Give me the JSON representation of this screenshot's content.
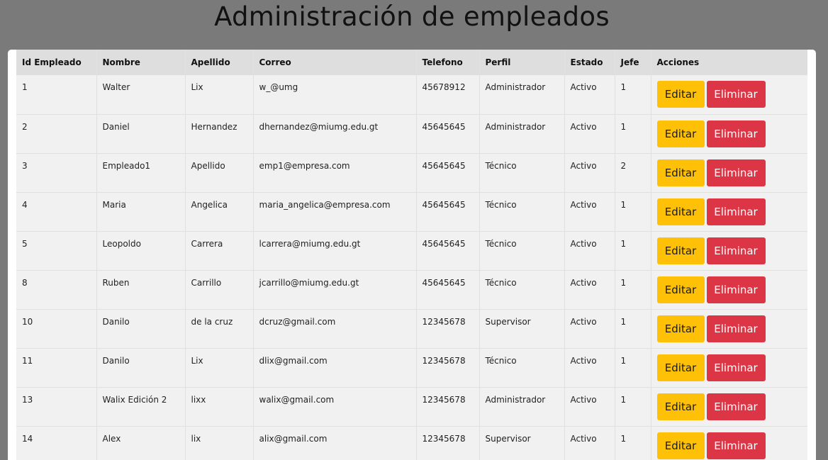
{
  "page": {
    "title": "Administración de empleados"
  },
  "table": {
    "headers": [
      "Id Empleado",
      "Nombre",
      "Apellido",
      "Correo",
      "Telefono",
      "Perfil",
      "Estado",
      "Jefe",
      "Acciones"
    ],
    "actions": {
      "edit_label": "Editar",
      "delete_label": "Eliminar"
    },
    "rows": [
      {
        "id": "1",
        "nombre": "Walter",
        "apellido": "Lix",
        "correo": "w_@umg",
        "telefono": "45678912",
        "perfil": "Administrador",
        "estado": "Activo",
        "jefe": "1"
      },
      {
        "id": "2",
        "nombre": "Daniel",
        "apellido": "Hernandez",
        "correo": "dhernandez@miumg.edu.gt",
        "telefono": "45645645",
        "perfil": "Administrador",
        "estado": "Activo",
        "jefe": "1"
      },
      {
        "id": "3",
        "nombre": "Empleado1",
        "apellido": "Apellido",
        "correo": "emp1@empresa.com",
        "telefono": "45645645",
        "perfil": "Técnico",
        "estado": "Activo",
        "jefe": "2"
      },
      {
        "id": "4",
        "nombre": "Maria",
        "apellido": "Angelica",
        "correo": "maria_angelica@empresa.com",
        "telefono": "45645645",
        "perfil": "Técnico",
        "estado": "Activo",
        "jefe": "1"
      },
      {
        "id": "5",
        "nombre": "Leopoldo",
        "apellido": "Carrera",
        "correo": "lcarrera@miumg.edu.gt",
        "telefono": "45645645",
        "perfil": "Técnico",
        "estado": "Activo",
        "jefe": "1"
      },
      {
        "id": "8",
        "nombre": "Ruben",
        "apellido": "Carrillo",
        "correo": "jcarrillo@miumg.edu.gt",
        "telefono": "45645645",
        "perfil": "Técnico",
        "estado": "Activo",
        "jefe": "1"
      },
      {
        "id": "10",
        "nombre": "Danilo",
        "apellido": "de la cruz",
        "correo": "dcruz@gmail.com",
        "telefono": "12345678",
        "perfil": "Supervisor",
        "estado": "Activo",
        "jefe": "1"
      },
      {
        "id": "11",
        "nombre": "Danilo",
        "apellido": "Lix",
        "correo": "dlix@gmail.com",
        "telefono": "12345678",
        "perfil": "Técnico",
        "estado": "Activo",
        "jefe": "1"
      },
      {
        "id": "13",
        "nombre": "Walix Edición 2",
        "apellido": "lixx",
        "correo": "walix@gmail.com",
        "telefono": "12345678",
        "perfil": "Administrador",
        "estado": "Activo",
        "jefe": "1"
      },
      {
        "id": "14",
        "nombre": "Alex",
        "apellido": "lix",
        "correo": "alix@gmail.com",
        "telefono": "12345678",
        "perfil": "Supervisor",
        "estado": "Activo",
        "jefe": "1"
      }
    ]
  },
  "colors": {
    "backdrop": "#7a7a7a",
    "header_bg": "#dedede",
    "row_bg": "#f1f1f1",
    "edit_button": "#ffc107",
    "delete_button": "#dc3545"
  }
}
